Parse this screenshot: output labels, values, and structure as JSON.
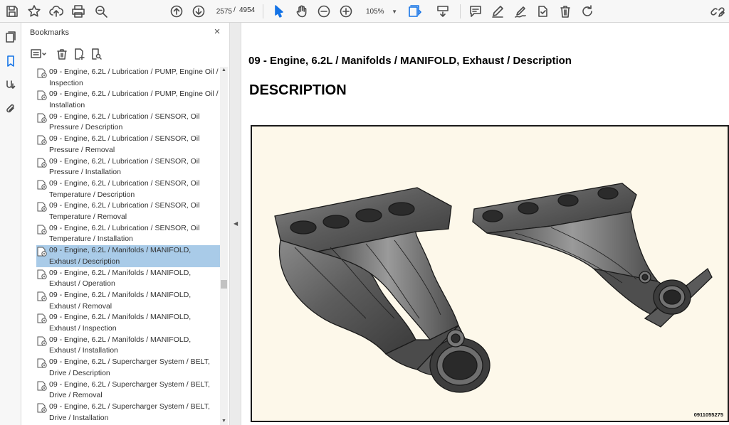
{
  "toolbar": {
    "page_current": "2575",
    "page_separator": "/",
    "page_total": "4954",
    "zoom": "105%",
    "icons": [
      "save-icon",
      "bookmark-star-icon",
      "upload-icon",
      "print-icon",
      "zoom-out-magnifier-icon",
      "page-up-icon",
      "page-down-icon",
      "select-arrow-icon",
      "hand-icon",
      "zoom-out-icon",
      "zoom-in-icon",
      "fit-page-icon",
      "scroll-mode-icon",
      "comment-icon",
      "pen-icon",
      "sign-icon",
      "stamp-icon",
      "trash-icon",
      "rotate-icon",
      "link-edit-icon"
    ]
  },
  "panel": {
    "title": "Bookmarks",
    "close": "×"
  },
  "bookmarks": [
    "09 - Engine, 6.2L / Lubrication / PUMP, Engine Oil / Inspection",
    "09 - Engine, 6.2L / Lubrication / PUMP, Engine Oil / Installation",
    "09 - Engine, 6.2L / Lubrication / SENSOR, Oil Pressure / Description",
    "09 - Engine, 6.2L / Lubrication / SENSOR, Oil Pressure / Removal",
    "09 - Engine, 6.2L / Lubrication / SENSOR, Oil Pressure / Installation",
    "09 - Engine, 6.2L / Lubrication / SENSOR, Oil Temperature / Description",
    "09 - Engine, 6.2L / Lubrication / SENSOR, Oil Temperature / Removal",
    "09 - Engine, 6.2L / Lubrication / SENSOR, Oil Temperature / Installation",
    "09 - Engine, 6.2L / Manifolds / MANIFOLD, Exhaust / Description",
    "09 - Engine, 6.2L / Manifolds / MANIFOLD, Exhaust / Operation",
    "09 - Engine, 6.2L / Manifolds / MANIFOLD, Exhaust / Removal",
    "09 - Engine, 6.2L / Manifolds / MANIFOLD, Exhaust / Inspection",
    "09 - Engine, 6.2L / Manifolds / MANIFOLD, Exhaust / Installation",
    "09 - Engine, 6.2L / Supercharger System / BELT, Drive / Description",
    "09 - Engine, 6.2L / Supercharger System / BELT, Drive / Removal",
    "09 - Engine, 6.2L / Supercharger System / BELT, Drive / Installation"
  ],
  "selected_bookmark_index": 8,
  "document": {
    "heading": "09 - Engine, 6.2L / Manifolds / MANIFOLD, Exhaust / Description",
    "title": "DESCRIPTION",
    "figure_id": "0911055275"
  },
  "colors": {
    "accent": "#1473e6",
    "selection": "#a9cbe8",
    "figure_bg": "#fdf8ea"
  }
}
